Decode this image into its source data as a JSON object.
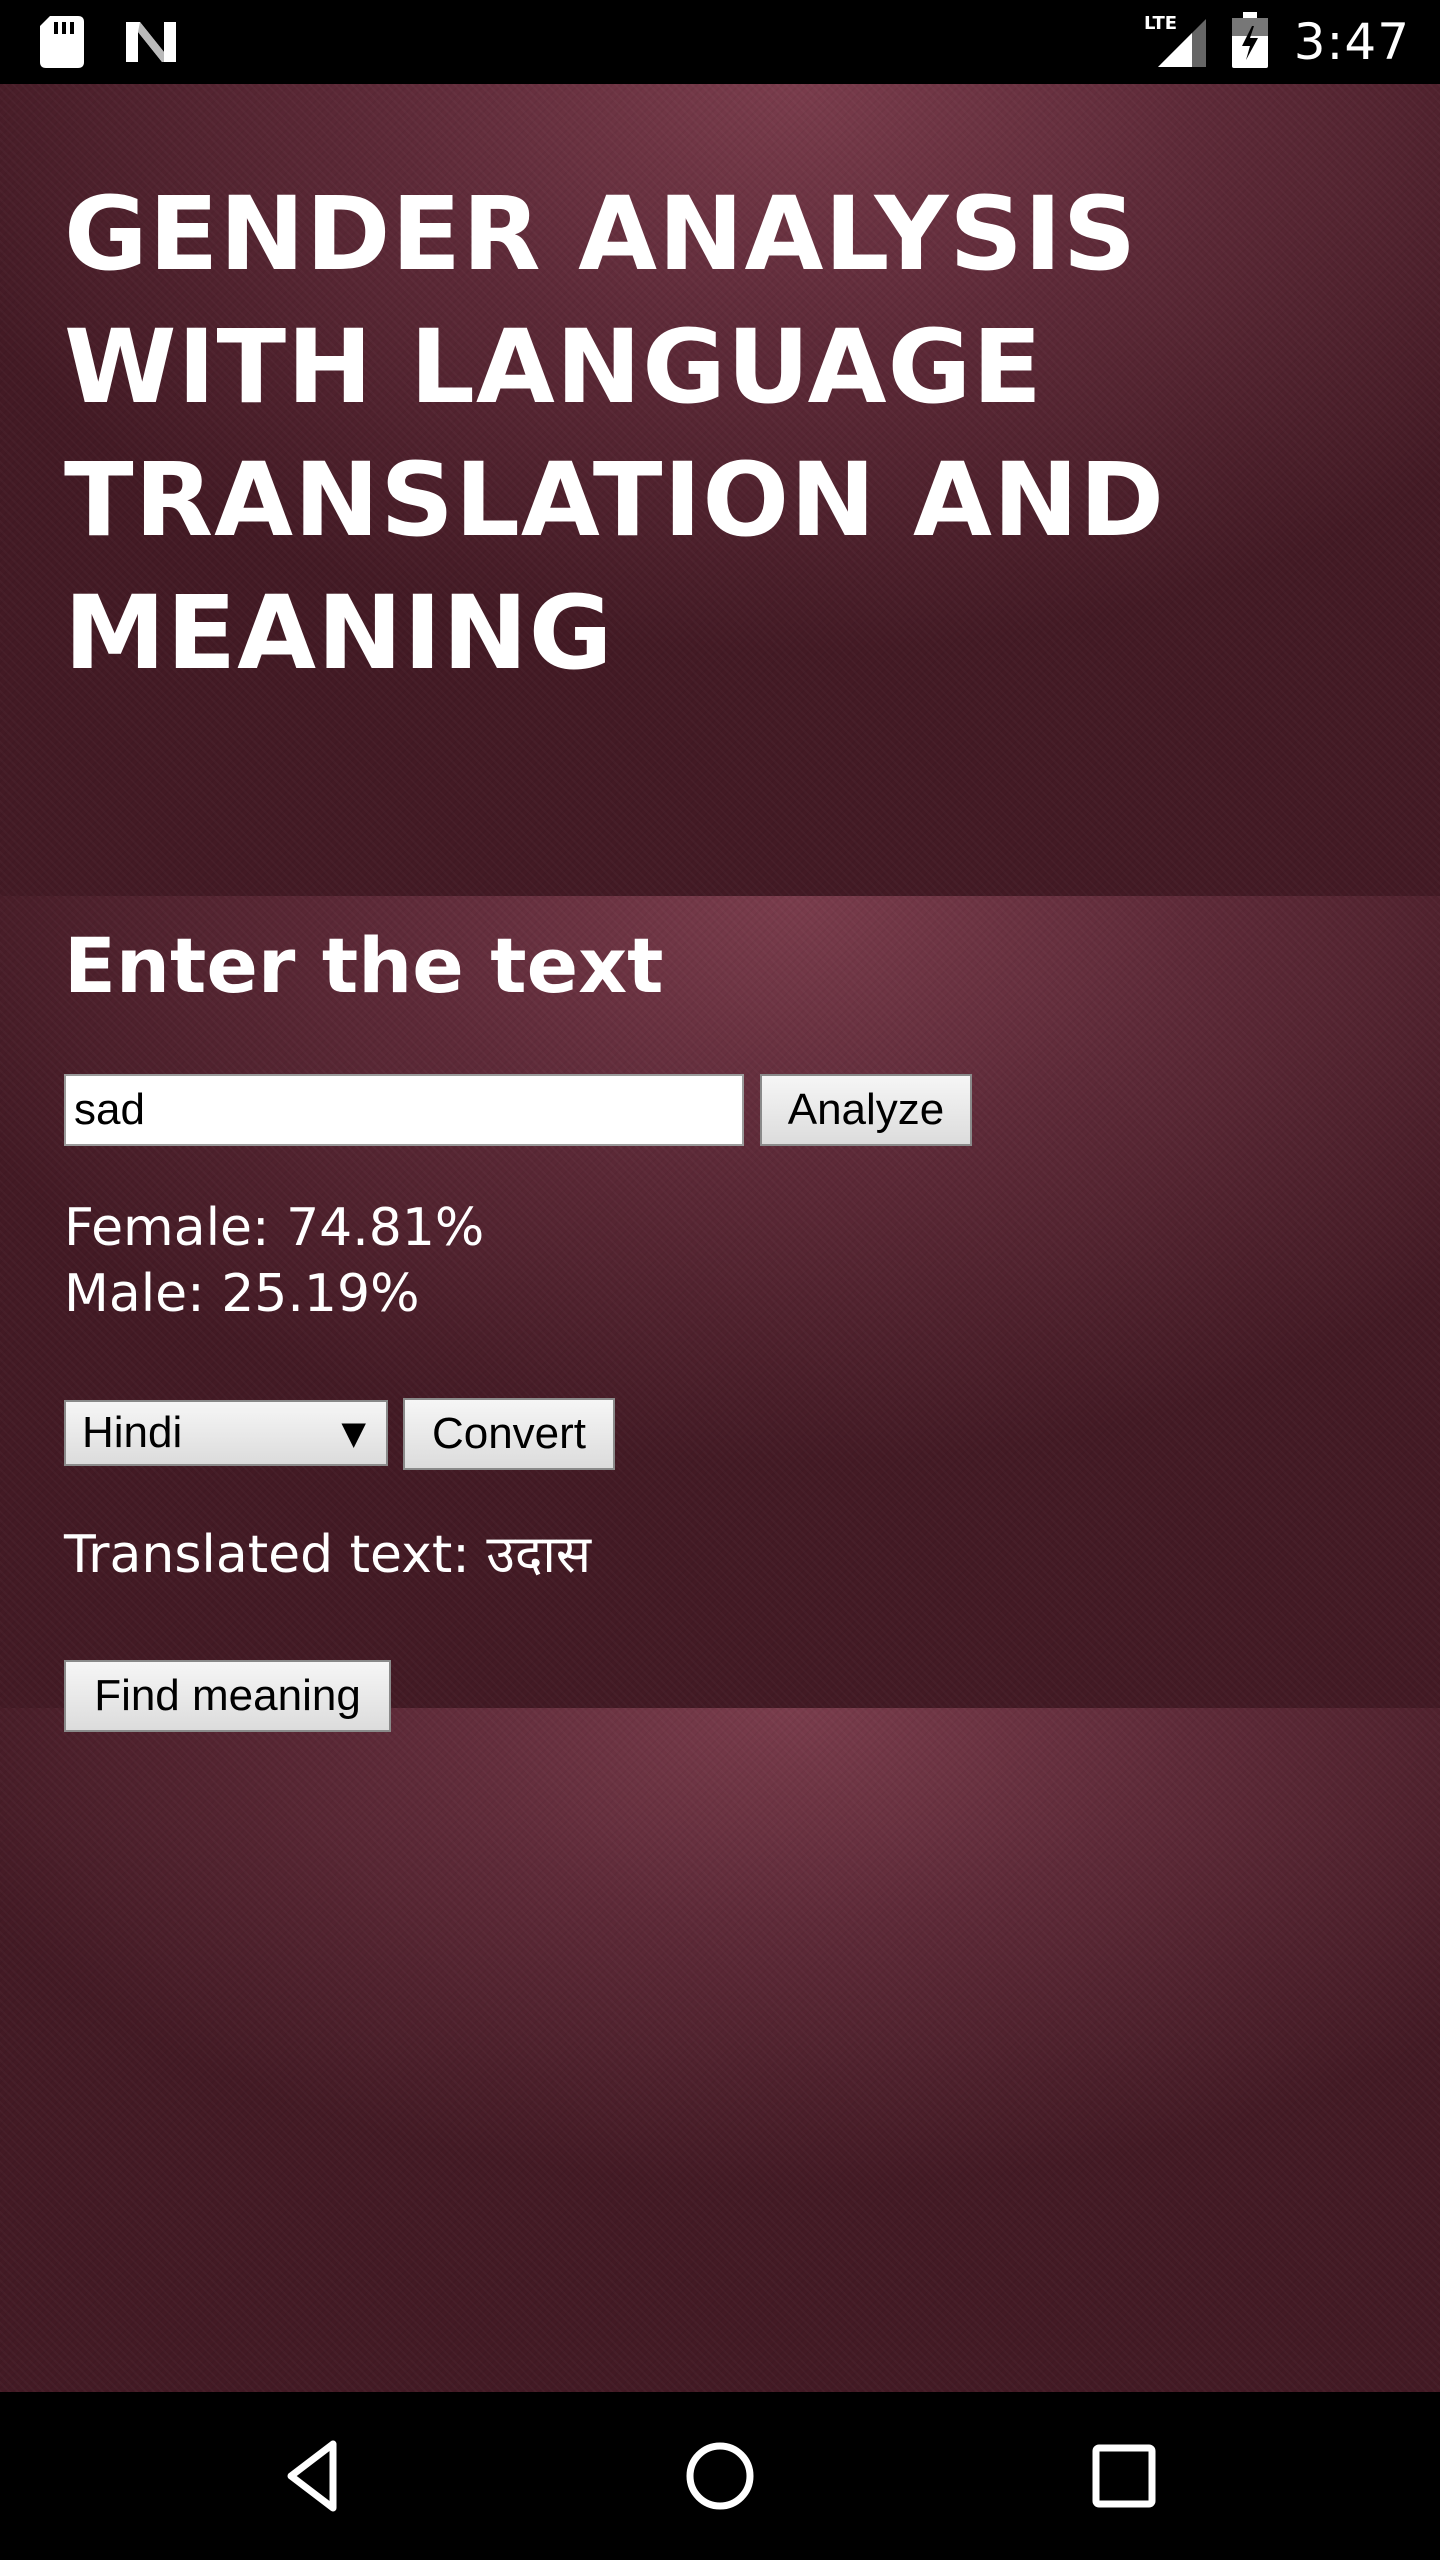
{
  "status_bar": {
    "time": "3:47",
    "network_label": "LTE",
    "icons": [
      "sd-card-icon",
      "n-logo-icon",
      "lte-signal-icon",
      "battery-charging-icon"
    ]
  },
  "header": {
    "title": "GENDER ANALYSIS WITH LANGUAGE TRANSLATION AND MEANING"
  },
  "main": {
    "heading": "Enter the text",
    "input_value": "sad",
    "analyze_label": "Analyze",
    "female_result": "Female: 74.81%",
    "male_result": "Male: 25.19%",
    "language_selected": "Hindi",
    "convert_label": "Convert",
    "translated_text": "Translated text: उदास",
    "find_meaning_label": "Find meaning"
  },
  "colors": {
    "background_light": "#7a3c4c",
    "background_dark": "#431a24",
    "text": "#ffffff",
    "system_bars": "#000000"
  },
  "nav_bar": {
    "icons": [
      "back-icon",
      "home-icon",
      "recents-icon"
    ]
  }
}
